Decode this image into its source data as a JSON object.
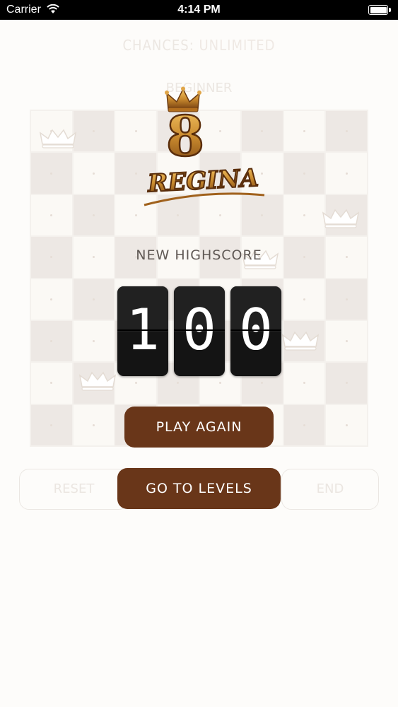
{
  "status_bar": {
    "carrier": "Carrier",
    "time": "4:14 PM"
  },
  "game": {
    "chances_label": "CHANCES:",
    "chances_value": "UNLIMITED",
    "level_name": "BEGINNER",
    "reset_label": "RESET",
    "end_label": "END"
  },
  "overlay": {
    "logo_number": "8",
    "logo_word": "REGINA",
    "highscore_label": "NEW HIGHSCORE",
    "score_digits": [
      "1",
      "0",
      "0"
    ],
    "play_again_label": "PLAY AGAIN",
    "go_to_levels_label": "GO TO LEVELS"
  },
  "colors": {
    "brand_brown": "#693619",
    "logo_gold": "#c98a2e",
    "score_card": "#141414"
  }
}
